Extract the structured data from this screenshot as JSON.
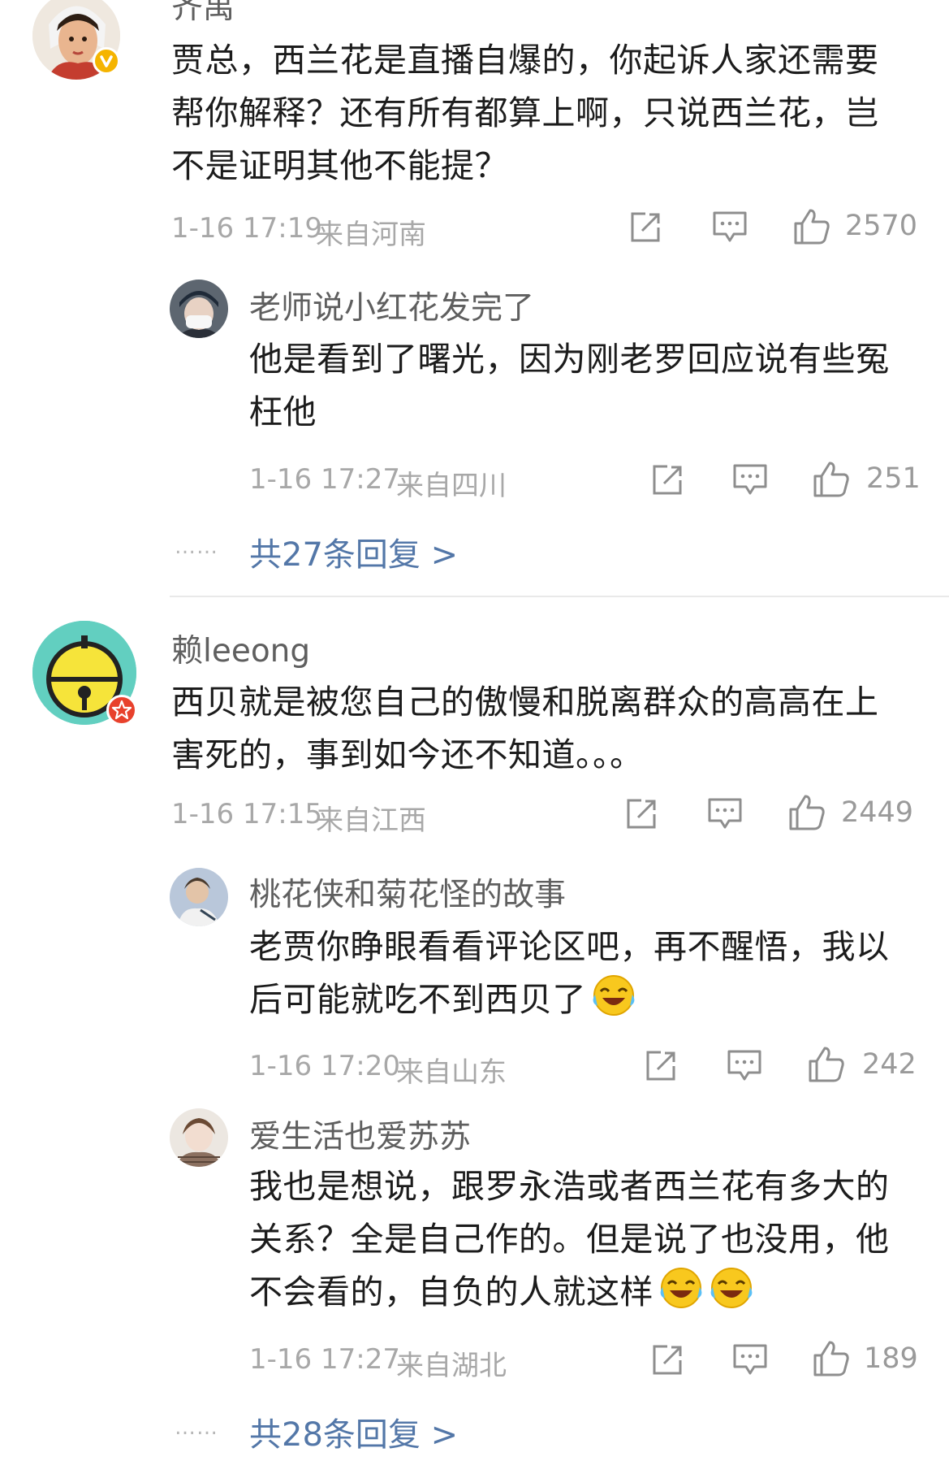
{
  "comments": [
    {
      "author": "齐禹",
      "text": "贾总，西兰花是直播自爆的，你起诉人家还需要帮你解释？还有所有都算上啊，只说西兰花，岂不是证明其他不能提？",
      "time": "1-16 17:19",
      "location": "来自河南",
      "likes": "2570",
      "badge_icon": "verified-v-icon",
      "replies": [
        {
          "author": "老师说小红花发完了",
          "text": "他是看到了曙光，因为刚老罗回应说有些冤枉他",
          "time": "1-16 17:27",
          "location": "来自四川",
          "likes": "251"
        }
      ],
      "more_replies": "共27条回复 >"
    },
    {
      "author": "赖leeong",
      "text": "西贝就是被您自己的傲慢和脱离群众的高高在上害死的，事到如今还不知道。。。",
      "time": "1-16 17:15",
      "location": "来自江西",
      "likes": "2449",
      "badge_icon": "red-star-badge-icon",
      "replies": [
        {
          "author": "桃花侠和菊花怪的故事",
          "text": "老贾你睁眼看看评论区吧，再不醒悟，我以后可能就吃不到西贝了",
          "time": "1-16 17:20",
          "location": "来自山东",
          "likes": "242",
          "emoji": [
            "laugh-cry-emoji-icon"
          ]
        },
        {
          "author": "爱生活也爱苏苏",
          "text": "我也是想说，跟罗永浩或者西兰花有多大的关系？全是自己作的。但是说了也没用，他不会看的，自负的人就这样",
          "time": "1-16 17:27",
          "location": "来自湖北",
          "likes": "189",
          "emoji": [
            "laugh-cry-emoji-icon",
            "laugh-cry-emoji-icon"
          ]
        }
      ],
      "more_replies": "共28条回复 >"
    }
  ],
  "dots": "……",
  "icons": {
    "share": "share-icon",
    "comment": "comment-icon",
    "like": "thumbs-up-icon"
  },
  "colors": {
    "link": "#5377a8",
    "meta": "#a8a8a8",
    "name": "#5f5f5f",
    "verified": "#f5b400",
    "red_badge": "#e8412c"
  }
}
